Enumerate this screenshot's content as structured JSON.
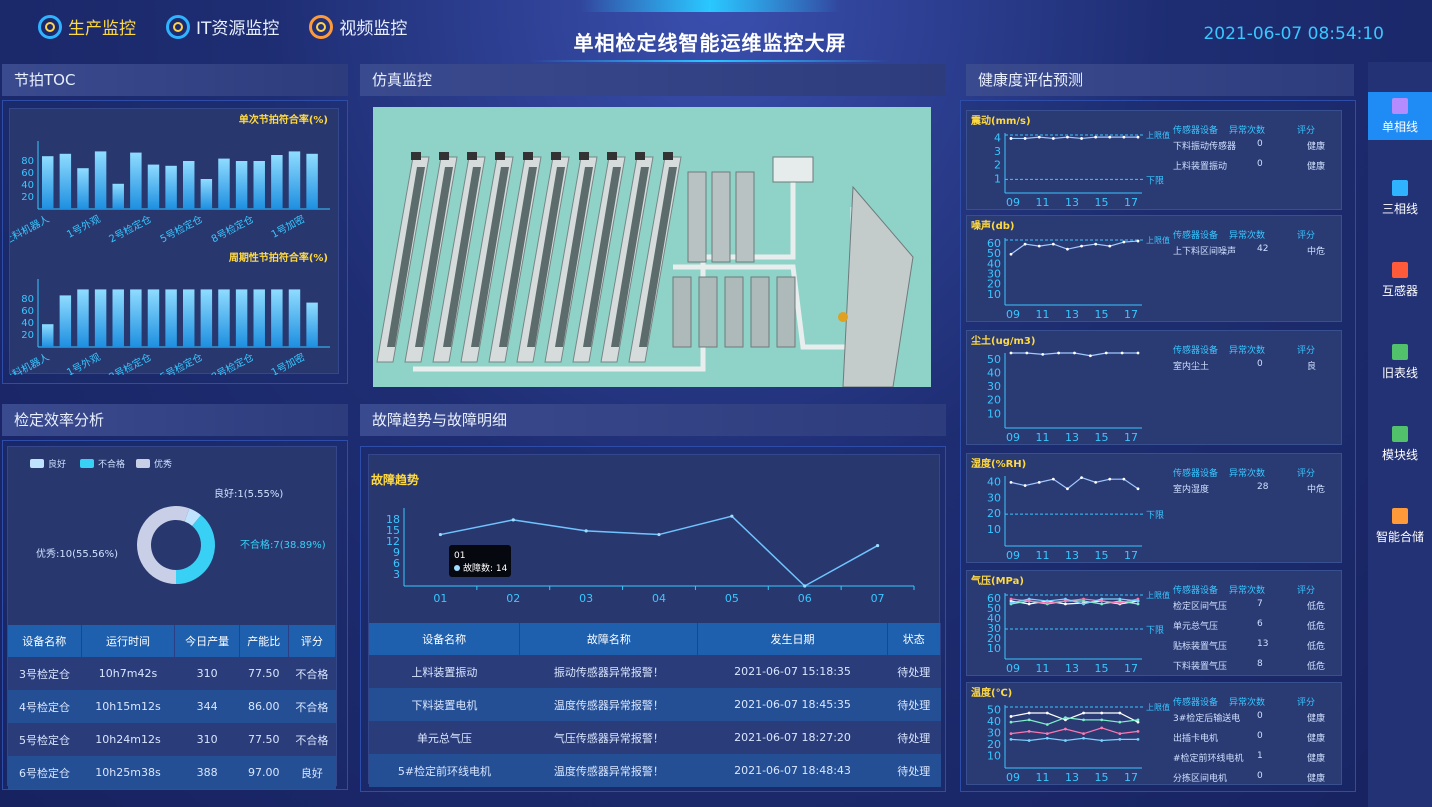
{
  "nav": [
    {
      "label": "生产监控",
      "active": true
    },
    {
      "label": "IT资源监控",
      "active": false
    },
    {
      "label": "视频监控",
      "active": false
    }
  ],
  "title": "单相检定线智能运维监控大屏",
  "datetime": "2021-06-07 08:54:10",
  "panels": {
    "toc": "节拍TOC",
    "sim": "仿真监控",
    "health": "健康度评估预测",
    "eff": "检定效率分析",
    "fault": "故障趋势与故障明细"
  },
  "sidebar": [
    {
      "label": "单相线",
      "active": true,
      "icon": "single-phase-icon"
    },
    {
      "label": "三相线",
      "active": false,
      "icon": "three-phase-icon"
    },
    {
      "label": "互感器",
      "active": false,
      "icon": "transformer-icon"
    },
    {
      "label": "旧表线",
      "active": false,
      "icon": "old-meter-icon"
    },
    {
      "label": "模块线",
      "active": false,
      "icon": "module-icon"
    },
    {
      "label": "智能合储",
      "active": false,
      "icon": "storage-icon"
    }
  ],
  "chart_data": [
    {
      "type": "bar",
      "title": "单次节拍符合率(%)",
      "categories": [
        "上料机器人",
        "",
        "1号外观",
        "",
        "2号检定仓",
        "",
        "5号检定仓",
        "",
        "8号检定仓",
        "",
        "1号加密",
        "",
        ""
      ],
      "values": [
        88,
        92,
        68,
        96,
        42,
        94,
        74,
        72,
        80,
        50,
        84,
        80,
        80,
        90,
        96,
        92
      ],
      "ylim": [
        0,
        100
      ],
      "yticks": [
        20,
        40,
        60,
        80
      ],
      "xtick_labels": [
        "上料机器人",
        "1号外观",
        "2号检定仓",
        "5号检定仓",
        "8号检定仓",
        "1号加密"
      ]
    },
    {
      "type": "bar",
      "title": "周期性节拍符合率(%)",
      "values": [
        38,
        86,
        96,
        96,
        96,
        96,
        96,
        96,
        96,
        96,
        96,
        96,
        96,
        96,
        96,
        74
      ],
      "ylim": [
        0,
        100
      ],
      "yticks": [
        20,
        40,
        60,
        80
      ],
      "xtick_labels": [
        "上料机器人",
        "1号外观",
        "2号检定仓",
        "5号检定仓",
        "8号检定仓",
        "1号加密"
      ]
    },
    {
      "type": "pie",
      "legend": [
        "良好",
        "不合格",
        "优秀"
      ],
      "slices": [
        {
          "name": "良好",
          "value": 1,
          "label": "良好:1(5.55%)",
          "color": "#bfe3ff"
        },
        {
          "name": "不合格",
          "value": 7,
          "label": "不合格:7(38.89%)",
          "color": "#39d0f5"
        },
        {
          "name": "优秀",
          "value": 10,
          "label": "优秀:10(55.56%)",
          "color": "#c9cfe6"
        }
      ]
    },
    {
      "type": "line",
      "title": "故障趋势",
      "x": [
        "01",
        "02",
        "03",
        "04",
        "05",
        "06",
        "07"
      ],
      "values": [
        14,
        18,
        15,
        14,
        19,
        0,
        11
      ],
      "yticks": [
        3,
        6,
        9,
        12,
        15,
        18
      ],
      "tooltip": {
        "x": "01",
        "label": "故障数:",
        "value": "14"
      }
    },
    {
      "type": "line",
      "title": "震动(mm/s)",
      "x": [
        "09",
        "11",
        "13",
        "15",
        "17"
      ],
      "series": [
        {
          "values": [
            4.0,
            4.0,
            4.1,
            4.0,
            4.1,
            4.0,
            4.1,
            4.1,
            4.1,
            4.1
          ]
        }
      ],
      "yticks": [
        1,
        2,
        3,
        4
      ],
      "upper": "上限值",
      "lower": "下限"
    },
    {
      "type": "line",
      "title": "噪声(db)",
      "x": [
        "09",
        "11",
        "13",
        "15",
        "17"
      ],
      "series": [
        {
          "values": [
            50,
            60,
            58,
            60,
            55,
            58,
            60,
            58,
            62,
            63
          ]
        }
      ],
      "yticks": [
        10,
        20,
        30,
        40,
        50,
        60
      ],
      "upper": "上限值"
    },
    {
      "type": "line",
      "title": "尘土(ug/m3)",
      "x": [
        "09",
        "11",
        "13",
        "15",
        "17"
      ],
      "series": [
        {
          "values": [
            55,
            55,
            54,
            55,
            55,
            53,
            55,
            55,
            55
          ]
        }
      ],
      "yticks": [
        10,
        20,
        30,
        40,
        50
      ]
    },
    {
      "type": "line",
      "title": "湿度(%RH)",
      "x": [
        "09",
        "11",
        "13",
        "15",
        "17"
      ],
      "series": [
        {
          "values": [
            40,
            38,
            40,
            42,
            36,
            43,
            40,
            42,
            42,
            36
          ]
        }
      ],
      "yticks": [
        10,
        20,
        30,
        40
      ],
      "lower": "下限"
    },
    {
      "type": "line",
      "title": "气压(MPa)",
      "x": [
        "09",
        "11",
        "13",
        "15",
        "17"
      ],
      "series": [
        {
          "values": [
            58,
            55,
            58,
            55,
            56,
            58,
            55,
            58
          ]
        },
        {
          "values": [
            55,
            58,
            55,
            58,
            58,
            55,
            58,
            55
          ]
        },
        {
          "values": [
            60,
            58,
            56,
            58,
            60,
            58,
            56,
            60
          ]
        },
        {
          "values": [
            56,
            60,
            58,
            60,
            55,
            60,
            60,
            58
          ]
        }
      ],
      "yticks": [
        10,
        20,
        30,
        40,
        50,
        60
      ],
      "upper": "上限值",
      "lower": "下限"
    },
    {
      "type": "line",
      "title": "温度(℃)",
      "x": [
        "09",
        "11",
        "13",
        "15",
        "17"
      ],
      "series": [
        {
          "values": [
            45,
            48,
            48,
            42,
            48,
            48,
            48,
            40
          ]
        },
        {
          "values": [
            40,
            42,
            38,
            44,
            42,
            42,
            40,
            42
          ]
        },
        {
          "values": [
            30,
            32,
            30,
            34,
            30,
            35,
            30,
            32
          ]
        },
        {
          "values": [
            25,
            24,
            26,
            24,
            26,
            24,
            25,
            25
          ]
        }
      ],
      "yticks": [
        10,
        20,
        30,
        40,
        50
      ],
      "upper": "上限值"
    }
  ],
  "health_cards": [
    {
      "head": [
        "传感器设备",
        "异常次数",
        "评分"
      ],
      "rows": [
        [
          "下料振动传感器",
          "0",
          "健康"
        ],
        [
          "上料装置振动",
          "0",
          "健康"
        ]
      ]
    },
    {
      "head": [
        "传感器设备",
        "异常次数",
        "评分"
      ],
      "rows": [
        [
          "上下料区间噪声",
          "42",
          "中危"
        ]
      ]
    },
    {
      "head": [
        "传感器设备",
        "异常次数",
        "评分"
      ],
      "rows": [
        [
          "室内尘土",
          "0",
          "良"
        ]
      ]
    },
    {
      "head": [
        "传感器设备",
        "异常次数",
        "评分"
      ],
      "rows": [
        [
          "室内湿度",
          "28",
          "中危"
        ]
      ]
    },
    {
      "head": [
        "传感器设备",
        "异常次数",
        "评分"
      ],
      "rows": [
        [
          "检定区间气压",
          "7",
          "低危"
        ],
        [
          "单元总气压",
          "6",
          "低危"
        ],
        [
          "贴标装置气压",
          "13",
          "低危"
        ],
        [
          "下料装置气压",
          "8",
          "低危"
        ]
      ]
    },
    {
      "head": [
        "传感器设备",
        "异常次数",
        "评分"
      ],
      "rows": [
        [
          "3#检定后输送电",
          "0",
          "健康"
        ],
        [
          "出插卡电机",
          "0",
          "健康"
        ],
        [
          "#检定前环线电机",
          "1",
          "健康"
        ],
        [
          "分拣区间电机",
          "0",
          "健康"
        ]
      ]
    }
  ],
  "eff_table": {
    "head": [
      "设备名称",
      "运行时间",
      "今日产量",
      "产能比",
      "评分"
    ],
    "rows": [
      [
        "3号检定仓",
        "10h7m42s",
        "310",
        "77.50",
        "不合格"
      ],
      [
        "4号检定仓",
        "10h15m12s",
        "344",
        "86.00",
        "不合格"
      ],
      [
        "5号检定仓",
        "10h24m12s",
        "310",
        "77.50",
        "不合格"
      ],
      [
        "6号检定仓",
        "10h25m38s",
        "388",
        "97.00",
        "良好"
      ]
    ]
  },
  "fault_table": {
    "head": [
      "设备名称",
      "故障名称",
      "发生日期",
      "状态"
    ],
    "rows": [
      [
        "上料装置振动",
        "振动传感器异常报警！",
        "2021-06-07 15:18:35",
        "待处理"
      ],
      [
        "下料装置电机",
        "温度传感器异常报警！",
        "2021-06-07 18:45:35",
        "待处理"
      ],
      [
        "单元总气压",
        "气压传感器异常报警！",
        "2021-06-07 18:27:20",
        "待处理"
      ],
      [
        "5#检定前环线电机",
        "温度传感器异常报警！",
        "2021-06-07 18:48:43",
        "待处理"
      ]
    ]
  }
}
